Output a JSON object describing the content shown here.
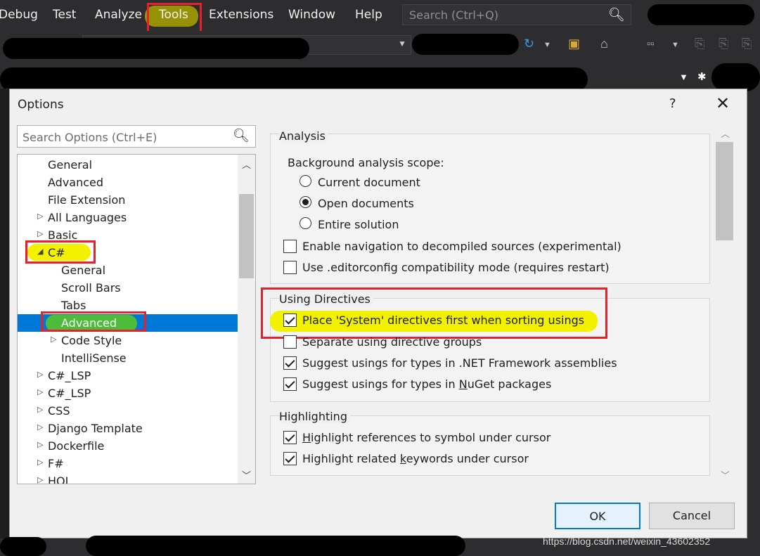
{
  "menu": {
    "items": [
      "Debug",
      "Test",
      "Analyze",
      "Tools",
      "Extensions",
      "Window",
      "Help"
    ],
    "search_placeholder": "Search (Ctrl+Q)"
  },
  "dialog": {
    "title": "Options",
    "help": "?",
    "close": "✕"
  },
  "left_panel": {
    "search_placeholder": "Search Options (Ctrl+E)",
    "tree": [
      {
        "label": "General",
        "arrow": ""
      },
      {
        "label": "Advanced",
        "arrow": ""
      },
      {
        "label": "File Extension",
        "arrow": ""
      },
      {
        "label": "All Languages",
        "arrow": "▷"
      },
      {
        "label": "Basic",
        "arrow": "▷"
      },
      {
        "label": "C#",
        "arrow": "◢"
      },
      {
        "label": "General",
        "arrow": ""
      },
      {
        "label": "Scroll Bars",
        "arrow": ""
      },
      {
        "label": "Tabs",
        "arrow": ""
      },
      {
        "label": "Advanced",
        "arrow": ""
      },
      {
        "label": "Code Style",
        "arrow": "▷"
      },
      {
        "label": "IntelliSense",
        "arrow": ""
      },
      {
        "label": "C#_LSP",
        "arrow": "▷"
      },
      {
        "label": "C#_LSP",
        "arrow": "▷"
      },
      {
        "label": "CSS",
        "arrow": "▷"
      },
      {
        "label": "Django Template",
        "arrow": "▷"
      },
      {
        "label": "Dockerfile",
        "arrow": "▷"
      },
      {
        "label": "F#",
        "arrow": "▷"
      },
      {
        "label": "HOL",
        "arrow": "▷"
      }
    ]
  },
  "analysis": {
    "title": "Analysis",
    "scope_label": "Background analysis scope:",
    "radios": [
      {
        "label": "Current document",
        "checked": false
      },
      {
        "label": "Open documents",
        "checked": true
      },
      {
        "label": "Entire solution",
        "checked": false
      }
    ],
    "checks": [
      {
        "label": "Enable navigation to decompiled sources (experimental)",
        "checked": false
      },
      {
        "label": "Use .editorconfig compatibility mode (requires restart)",
        "checked": false
      }
    ]
  },
  "using_directives": {
    "title": "Using Directives",
    "checks": [
      {
        "label": "Place 'System' directives first when sorting usings",
        "checked": true
      },
      {
        "label": "Separate using directive groups",
        "checked": false
      },
      {
        "label": "Suggest usings for types in .NET Framework assemblies",
        "checked": true
      },
      {
        "label_pre": "Suggest usings for types in ",
        "label_ul": "N",
        "label_post": "uGet packages",
        "checked": true
      }
    ]
  },
  "highlighting": {
    "title": "Highlighting",
    "checks": [
      {
        "label_ul": "H",
        "label_post": "ighlight references to symbol under cursor",
        "checked": true
      },
      {
        "label_pre": "Highlight related ",
        "label_ul": "k",
        "label_post": "eywords under cursor",
        "checked": true
      }
    ]
  },
  "buttons": {
    "ok": "OK",
    "cancel": "Cancel"
  },
  "watermark": "https://blog.csdn.net/weixin_43602352",
  "colors": {
    "accent": "#0078d7",
    "annotation_red": "#e8202a",
    "highlight_yellow": "#f2f200",
    "highlight_green": "#4cbc3a"
  }
}
